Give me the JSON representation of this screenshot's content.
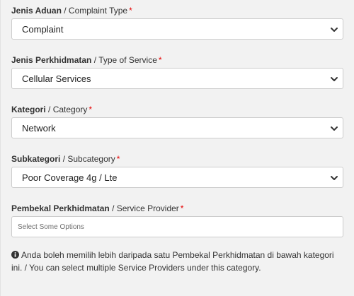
{
  "form": {
    "complaint_type": {
      "label_ms": "Jenis Aduan",
      "label_sep": " / ",
      "label_en": "Complaint Type",
      "required_mark": "*",
      "selected_value": "Complaint"
    },
    "service_type": {
      "label_ms": "Jenis Perkhidmatan",
      "label_sep": " / ",
      "label_en": "Type of Service",
      "required_mark": "*",
      "selected_value": "Cellular Services"
    },
    "category": {
      "label_ms": "Kategori",
      "label_sep": " / ",
      "label_en": "Category",
      "required_mark": "*",
      "selected_value": "Network"
    },
    "subcategory": {
      "label_ms": "Subkategori",
      "label_sep": " / ",
      "label_en": "Subcategory",
      "required_mark": "*",
      "selected_value": "Poor Coverage 4g / Lte"
    },
    "service_provider": {
      "label_ms": "Pembekal Perkhidmatan",
      "label_sep": " / ",
      "label_en": "Service Provider",
      "required_mark": "*",
      "placeholder": "Select Some Options"
    },
    "help_note": "Anda boleh memilih lebih daripada satu Pembekal Perkhidmatan di bawah kategori ini. / You can select multiple Service Providers under this category.",
    "help_icon": "info-circle-icon"
  },
  "colors": {
    "background": "#f2f2f2",
    "input_background": "#ffffff",
    "input_border": "#cccccc",
    "required": "#e60000",
    "text": "#333333"
  }
}
